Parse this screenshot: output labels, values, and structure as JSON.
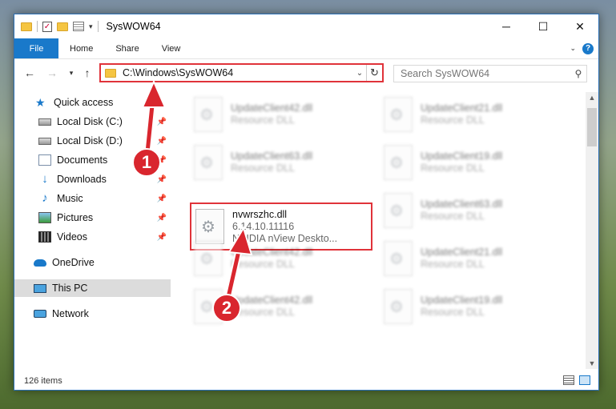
{
  "window": {
    "title": "SysWOW64",
    "controls": {
      "minimize": "─",
      "maximize": "☐",
      "close": "✕"
    }
  },
  "ribbon": {
    "tabs": [
      {
        "label": "File"
      },
      {
        "label": "Home"
      },
      {
        "label": "Share"
      },
      {
        "label": "View"
      }
    ]
  },
  "address": {
    "path": "C:\\Windows\\SysWOW64"
  },
  "search": {
    "placeholder": "Search SysWOW64"
  },
  "sidebar": {
    "quick_access": "Quick access",
    "items": [
      {
        "label": "Local Disk (C:)",
        "icon": "disk-icon",
        "pinned": true
      },
      {
        "label": "Local Disk (D:)",
        "icon": "disk-icon",
        "pinned": true
      },
      {
        "label": "Documents",
        "icon": "documents-icon",
        "pinned": true
      },
      {
        "label": "Downloads",
        "icon": "downloads-icon",
        "pinned": true
      },
      {
        "label": "Music",
        "icon": "music-icon",
        "pinned": true
      },
      {
        "label": "Pictures",
        "icon": "pictures-icon",
        "pinned": true
      },
      {
        "label": "Videos",
        "icon": "videos-icon",
        "pinned": true
      }
    ],
    "onedrive": "OneDrive",
    "this_pc": "This PC",
    "network": "Network"
  },
  "files": {
    "left": [
      {
        "name": "UpdateClient42.dll",
        "sub": "Resource DLL",
        "extra": ""
      },
      {
        "name": "UpdateClient63.dll",
        "sub": "Resource DLL",
        "extra": ""
      },
      {
        "name": "nvwrszhc.dll",
        "sub": "6.14.10.11116",
        "extra": "NVIDIA nView Deskto..."
      },
      {
        "name": "UpdateClient42.dll",
        "sub": "Resource DLL",
        "extra": ""
      },
      {
        "name": "UpdateClient42.dll",
        "sub": "Resource DLL",
        "extra": ""
      }
    ],
    "right": [
      {
        "name": "UpdateClient21.dll",
        "sub": "Resource DLL"
      },
      {
        "name": "UpdateClient19.dll",
        "sub": "Resource DLL"
      },
      {
        "name": "UpdateClient63.dll",
        "sub": "Resource DLL"
      },
      {
        "name": "UpdateClient21.dll",
        "sub": "Resource DLL"
      },
      {
        "name": "UpdateClient19.dll",
        "sub": "Resource DLL"
      }
    ]
  },
  "status": {
    "item_count": "126 items"
  },
  "annotations": {
    "badge1": "1",
    "badge2": "2",
    "color": "#d9262e"
  },
  "colors": {
    "accent": "#1979ca",
    "highlight_border": "#e0333a"
  }
}
